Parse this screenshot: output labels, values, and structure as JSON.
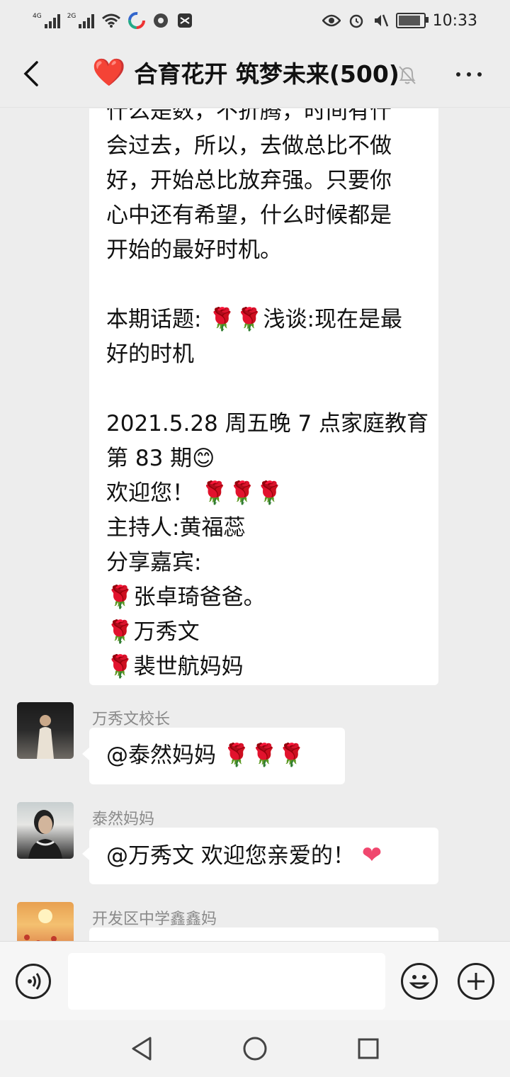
{
  "status": {
    "signal1_label": "4G",
    "signal2_label": "2G",
    "time": "10:33",
    "icons": [
      "signal-icon",
      "wifi-icon",
      "app-icon",
      "app-icon",
      "app-icon",
      "eye-icon",
      "alarm-icon",
      "mute-icon",
      "battery-icon"
    ]
  },
  "header": {
    "back_icon": "chevron-left-icon",
    "heart": "❤️",
    "title": "合育花开 筑梦未来(500)",
    "mute_icon": "bell-off-icon",
    "more_icon": "more-icon"
  },
  "messages": {
    "long": {
      "lines": [
        "什么是数，不折腾，时间有什",
        "会过去，所以，去做总比不做",
        "好，开始总比放弃强。只要你",
        "心中还有希望，什么时候都是",
        "开始的最好时机。",
        "",
        "本期话题: 🌹🌹浅谈:现在是最",
        "好的时机",
        "",
        "2021.5.28 周五晚 7 点家庭教育",
        "第 83 期😊",
        "欢迎您！ 🌹🌹🌹",
        "主持人:黄福蕊",
        "分享嘉宾:",
        "🌹张卓琦爸爸。",
        "🌹万秀文",
        "🌹裴世航妈妈"
      ]
    },
    "m1": {
      "sender": "万秀文校长",
      "text": "@泰然妈妈 🌹🌹🌹"
    },
    "m2": {
      "sender": "泰然妈妈",
      "text": "@万秀文  欢迎您亲爱的！",
      "emoji": "❤"
    },
    "m3": {
      "sender": "开发区中学鑫鑫妈"
    }
  },
  "input": {
    "voice_icon": "voice-icon",
    "emoji_icon": "emoji-icon",
    "plus_icon": "plus-icon",
    "value": ""
  },
  "nav": {
    "back_icon": "triangle-back-icon",
    "home_icon": "circle-home-icon",
    "recent_icon": "square-recent-icon"
  }
}
